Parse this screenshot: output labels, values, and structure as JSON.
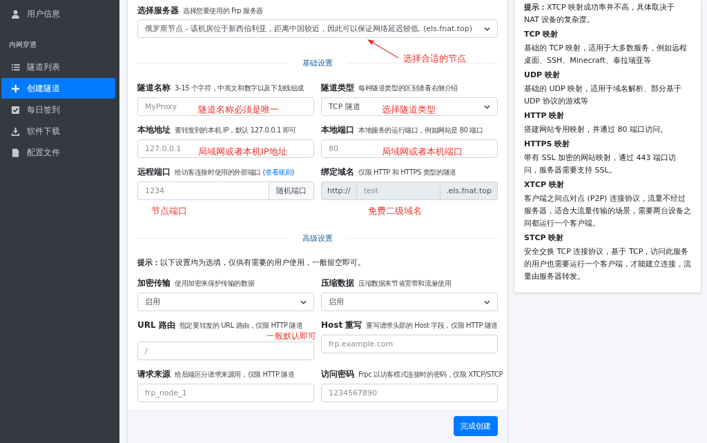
{
  "sidebar": {
    "items": [
      {
        "label": "用户信息",
        "kind": "user",
        "selected": false
      }
    ],
    "section_title": "内网穿透",
    "section_items": [
      {
        "label": "隧道列表",
        "kind": "list",
        "selected": false
      },
      {
        "label": "创建隧道",
        "kind": "plus",
        "selected": true
      },
      {
        "label": "每日签到",
        "kind": "check",
        "selected": false
      },
      {
        "label": "软件下载",
        "kind": "download",
        "selected": false
      },
      {
        "label": "配置文件",
        "kind": "file",
        "selected": false
      }
    ]
  },
  "server": {
    "label": "选择服务器",
    "hint": "选择您要使用的 Frp 服务器",
    "value": "俄罗斯节点 - 该机房位于新西伯利亚，距离中国较近，因此可以保证网络延迟较低. (els.fnat.top)",
    "note": "选择合适的节点"
  },
  "basic_divider": "基础设置",
  "basic_fields": [
    {
      "kind": "input",
      "label": "隧道名称",
      "hint": "3-15 个字符，中英文和数字以及下划线组成",
      "placeholder": "MyProxy",
      "note": "隧道名称必须是唯一"
    },
    {
      "kind": "select",
      "label": "隧道类型",
      "hint": "每种隧道类型的区别请看右侧介绍",
      "value": "TCP 隧道",
      "note": "选择隧道类型"
    },
    {
      "kind": "input",
      "label": "本地地址",
      "hint": "要转发到的本机 IP，默认 127.0.0.1 即可",
      "placeholder": "127.0.0.1",
      "note": "局域网或者本机IP地址"
    },
    {
      "kind": "input",
      "label": "本地端口",
      "hint": "本地服务的运行端口，例如网站是 80 端口",
      "placeholder": "80",
      "note": "局域网或者本机端口"
    },
    {
      "kind": "input-button",
      "label": "远程端口",
      "hint": "给访客连接时使用的外部端口 (",
      "link": "查看规则",
      "hint_after": ")",
      "placeholder": "1234",
      "button": "随机端口",
      "below_note": "节点端口"
    },
    {
      "kind": "input-group",
      "label": "绑定域名",
      "hint": "仅限 HTTP 和 HTTPS 类型的隧道",
      "prefix": "http://",
      "placeholder": "test",
      "suffix": ".els.fnat.top",
      "below_note": "免费二级域名"
    }
  ],
  "advanced_divider": "高级设置",
  "advanced_tip": "**提示：**以下设置均为选填，仅供有需要的用户使用，一般留空即可。",
  "advanced_fields": [
    {
      "kind": "select",
      "label": "加密传输",
      "hint": "使用加密来保护传输的数据",
      "value": "启用"
    },
    {
      "kind": "select",
      "label": "压缩数据",
      "hint": "压缩数据来节省宽带和流量使用",
      "value": "启用"
    },
    {
      "kind": "input",
      "label": "URL 路由",
      "hint": "指定要转发的 URL 路由，仅限 HTTP 隧道",
      "placeholder": "/",
      "above_note": "一般默认即可"
    },
    {
      "kind": "input",
      "label": "Host 重写",
      "hint": "重写请求头部的 Host 字段，仅限 HTTP 隧道",
      "placeholder": "frp.example.com"
    },
    {
      "kind": "input",
      "label": "请求来源",
      "hint": "给后端区分请求来源用，仅限 HTTP 隧道",
      "placeholder": "frp_node_1"
    },
    {
      "kind": "input",
      "label": "访问密码",
      "hint": "Frpc 以访客模式连接时的密码，仅限 XTCP/STCP",
      "placeholder": "1234567890"
    }
  ],
  "submit_button": "完成创建",
  "help": {
    "tip": "**提示：**XTCP 映射成功率并不高，具体取决于 NAT 设备的复杂度。",
    "sections": [
      {
        "title": "TCP 映射",
        "text": "基础的 TCP 映射，适用于大多数服务，例如远程桌面、SSH、Minecraft、泰拉瑞亚等"
      },
      {
        "title": "UDP 映射",
        "text": "基础的 UDP 映射，适用于域名解析、部分基于 UDP 协议的游戏等"
      },
      {
        "title": "HTTP 映射",
        "text": "搭建网站专用映射，并通过 80 端口访问。"
      },
      {
        "title": "HTTPS 映射",
        "text": "带有 SSL 加密的网站映射，通过 443 端口访问，服务器需要支持 SSL。"
      },
      {
        "title": "XTCP 映射",
        "text": "客户端之间点对点 (P2P) 连接协议，流量不经过服务器，适合大流量传输的场景，需要两台设备之间都运行一个客户端。"
      },
      {
        "title": "STCP 映射",
        "text": "安全交换 TCP 连接协议，基于 TCP，访问此服务的用户也需要运行一个客户端，才能建立连接，流量由服务器转发。"
      }
    ]
  }
}
